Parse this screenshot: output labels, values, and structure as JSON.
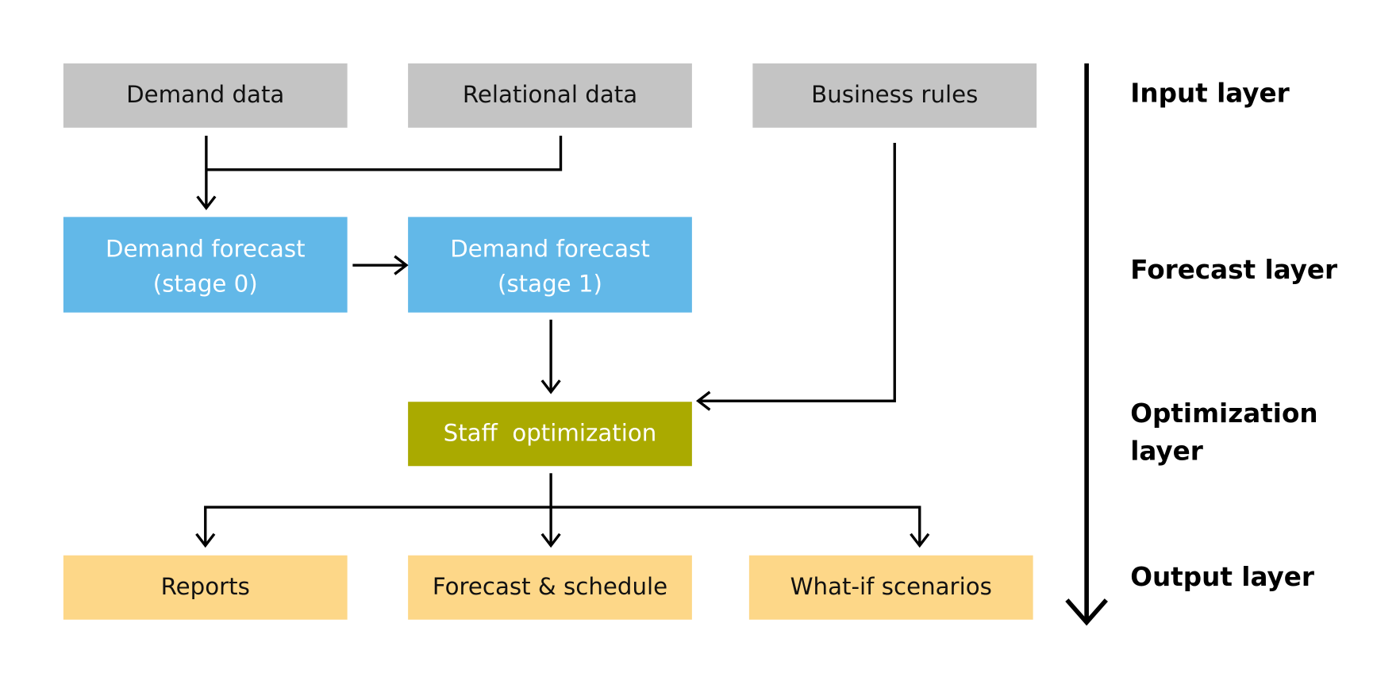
{
  "colors": {
    "input": "#c4c4c4",
    "forecast": "#62b8e8",
    "optimization": "#aaaa00",
    "output": "#fdd788"
  },
  "boxes": {
    "demand_data": "Demand data",
    "relational_data": "Relational data",
    "business_rules": "Business rules",
    "forecast0_line1": "Demand forecast",
    "forecast0_line2": "(stage 0)",
    "forecast1_line1": "Demand forecast",
    "forecast1_line2": "(stage 1)",
    "staff_optimization": "Staff  optimization",
    "reports": "Reports",
    "forecast_schedule": "Forecast & schedule",
    "what_if": "What-if scenarios"
  },
  "layers": {
    "input": "Input layer",
    "forecast": "Forecast layer",
    "optimization_line1": "Optimization",
    "optimization_line2": "layer",
    "output": "Output layer"
  }
}
